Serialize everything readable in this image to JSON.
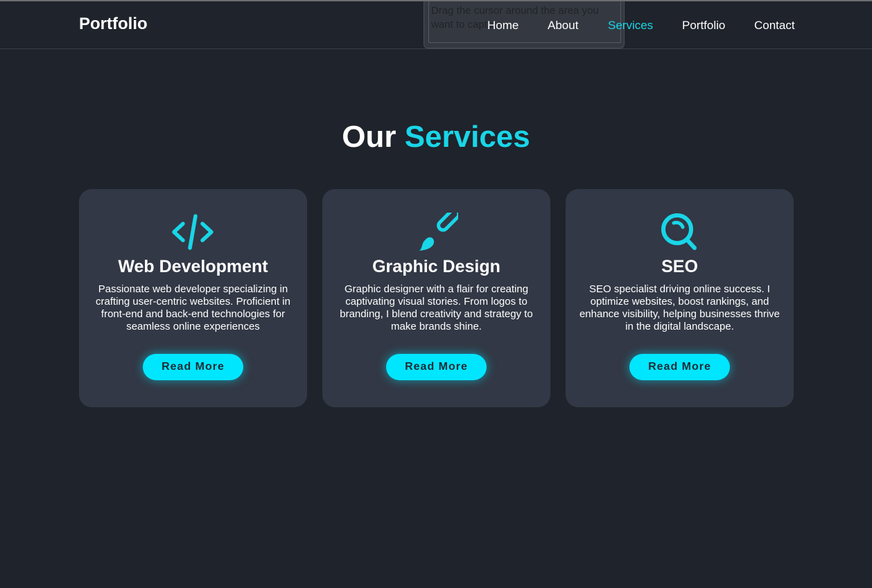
{
  "header": {
    "logo": "Portfolio",
    "nav": {
      "home": "Home",
      "about": "About",
      "services": "Services",
      "portfolio": "Portfolio",
      "contact": "Contact"
    },
    "active_nav": "Services"
  },
  "capture_overlay": {
    "text": "Drag the cursor around the area you want to capture."
  },
  "services": {
    "title_main": "Our",
    "title_accent": "Services",
    "cards": [
      {
        "icon": "code-icon",
        "title": "Web Development",
        "description": "Passionate web developer specializing in crafting user-centric websites. Proficient in front-end and back-end technologies for seamless online experiences",
        "button": "Read More"
      },
      {
        "icon": "paintbrush-icon",
        "title": "Graphic Design",
        "description": "Graphic designer with a flair for creating captivating visual stories. From logos to branding, I blend creativity and strategy to make brands shine.",
        "button": "Read More"
      },
      {
        "icon": "search-icon",
        "title": "SEO",
        "description": "SEO specialist driving online success. I optimize websites, boost rankings, and enhance visibility, helping businesses thrive in the digital landscape.",
        "button": "Read More"
      }
    ]
  },
  "colors": {
    "background": "#1f232b",
    "card": "#323845",
    "accent": "#19d6e8",
    "button": "#00e6ff"
  }
}
